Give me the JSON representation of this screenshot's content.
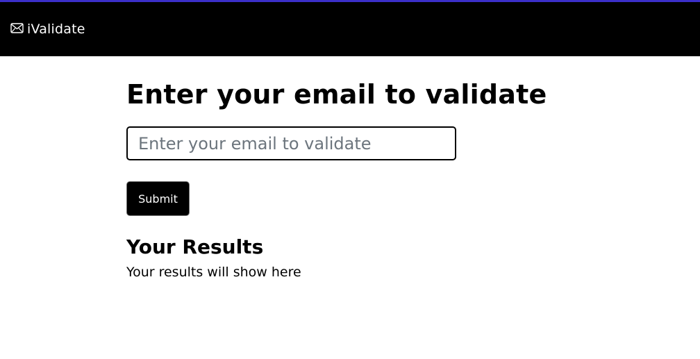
{
  "colors": {
    "accent_line": "#3b2fc9",
    "navbar_bg": "#000000",
    "button_bg": "#000000",
    "placeholder": "#6c757d"
  },
  "navbar": {
    "icon": "envelope-icon",
    "brand": "iValidate"
  },
  "form": {
    "title": "Enter your email to validate",
    "email_value": "",
    "email_placeholder": "Enter your email to validate",
    "submit_label": "Submit"
  },
  "results": {
    "heading": "Your Results",
    "text": "Your results will show here"
  }
}
